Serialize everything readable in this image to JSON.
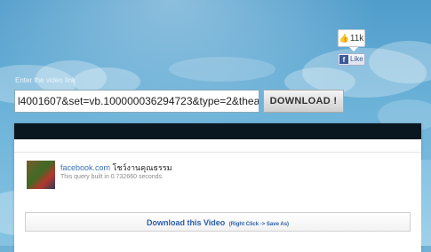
{
  "social": {
    "like_count": "11k",
    "like_button_label": "Like",
    "like_icon": "thumbs-up-icon",
    "facebook_icon": "facebook-f-icon"
  },
  "form": {
    "label": "Enter the video link",
    "url_value": "l4001607&set=vb.100000036294723&type=2&theater",
    "download_button": "DOWNLOAD !"
  },
  "result": {
    "page_domain": "facebook.com",
    "page_name": "โชว์งานคุณธรรม",
    "query_time": "This query built in 0.732660 seconds.",
    "download_link": "Download this Video",
    "download_hint": "(Right Click -> Save As)"
  },
  "colors": {
    "background": "#6fb2d6",
    "panel_bar": "#0b1720",
    "link": "#2a5ea8",
    "facebook": "#3b5998"
  }
}
